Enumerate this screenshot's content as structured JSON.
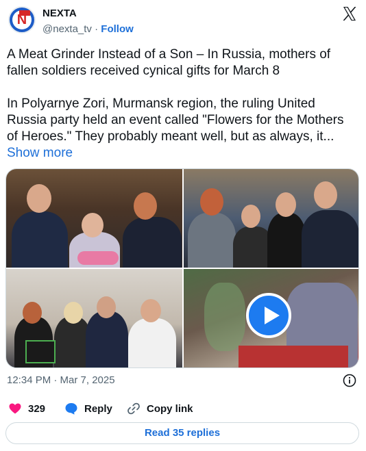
{
  "author": {
    "name": "NEXTA",
    "handle": "@nexta_tv",
    "separator": "·",
    "follow_label": "Follow",
    "avatar_letter": "N"
  },
  "tweet": {
    "headline": "A Meat Grinder Instead of a Son – In Russia, mothers of fallen soldiers received cynical gifts for March 8",
    "body": "In Polyarnye Zori, Murmansk region, the ruling United Russia party held an event called \"Flowers for the Mothers of Heroes.\" They probably meant well, but as always, it...",
    "show_more_label": "Show more"
  },
  "media": {
    "items": [
      {
        "kind": "photo"
      },
      {
        "kind": "photo"
      },
      {
        "kind": "photo"
      },
      {
        "kind": "video"
      }
    ]
  },
  "meta": {
    "timestamp": "12:34 PM · Mar 7, 2025"
  },
  "actions": {
    "likes_count": "329",
    "reply_label": "Reply",
    "copy_link_label": "Copy link"
  },
  "footer": {
    "read_replies_label": "Read 35 replies"
  },
  "colors": {
    "accent": "#1d6fd8",
    "like": "#f91880",
    "secondary_text": "#536471",
    "border": "#cfd9de"
  },
  "icons": [
    "x-logo-icon",
    "info-icon",
    "heart-icon",
    "reply-bubble-icon",
    "link-icon",
    "play-icon"
  ]
}
